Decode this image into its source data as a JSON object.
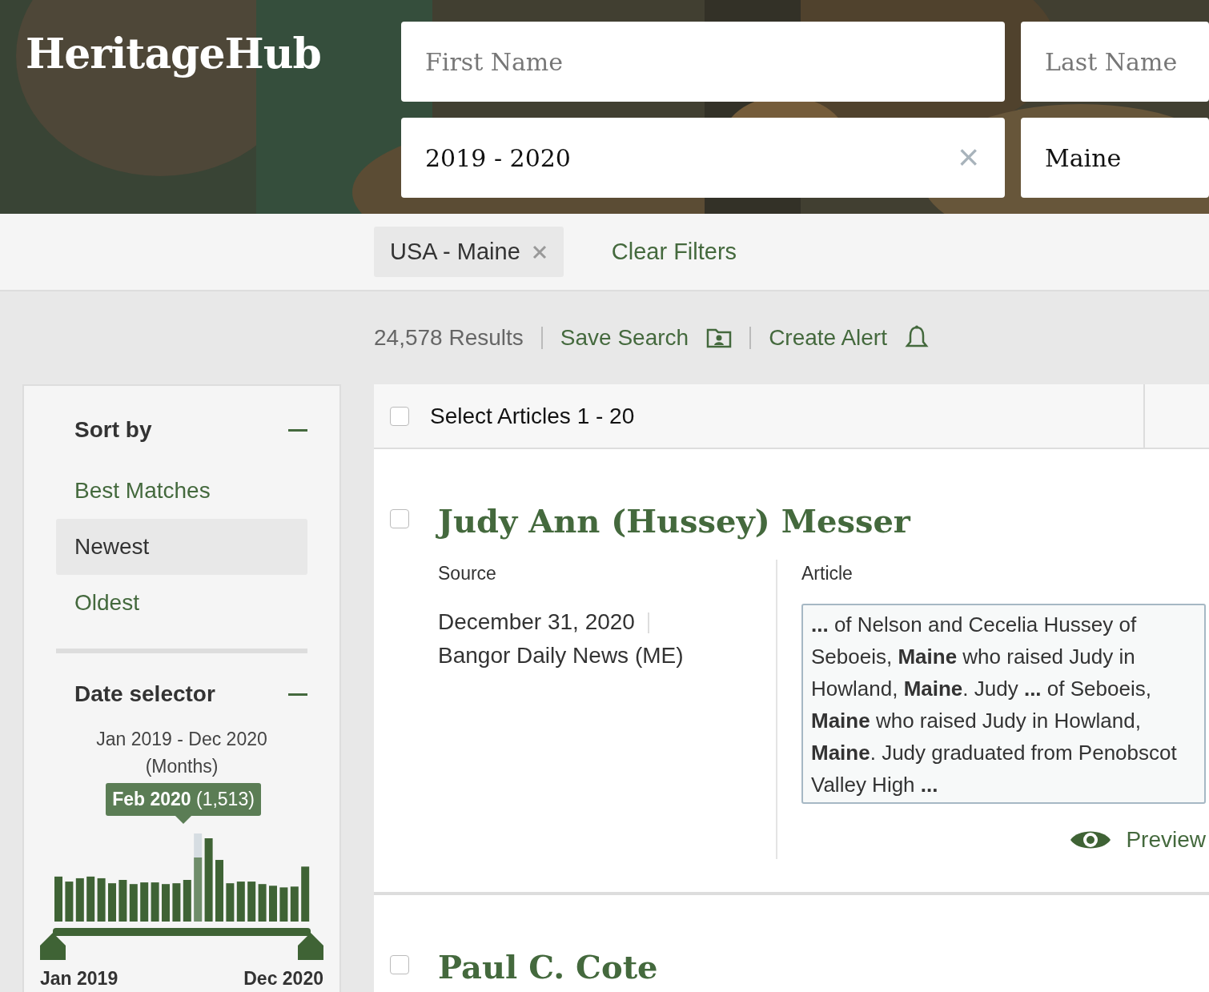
{
  "brand": "HeritageHub",
  "search_fields": [
    {
      "kind": "text",
      "placeholder": "First Name"
    },
    {
      "kind": "text",
      "placeholder": "Last Name"
    },
    {
      "kind": "clearable",
      "value": "2019 - 2020",
      "clear_icon": "×"
    },
    {
      "kind": "text",
      "value": "Maine"
    }
  ],
  "filters": {
    "chips": [
      {
        "label": "USA - Maine"
      }
    ],
    "clear_label": "Clear Filters"
  },
  "results_bar": {
    "count": "24,578 Results",
    "save_search": "Save Search",
    "create_alert": "Create Alert"
  },
  "sort": {
    "title": "Sort by",
    "options": [
      {
        "label": "Best Matches",
        "selected": false
      },
      {
        "label": "Newest",
        "selected": true
      },
      {
        "label": "Oldest",
        "selected": false
      }
    ]
  },
  "date_selector": {
    "title": "Date selector",
    "range": "Jan 2019 - Dec 2020",
    "unit": "(Months)",
    "tooltip": "**Feb 2020** (1,513)",
    "handles": [
      {
        "level": 0
      },
      {
        "level": 1
      }
    ],
    "start_label": "Jan 2019",
    "end_label": "Dec 2020"
  },
  "select_all": {
    "label": "Select Articles 1 - 20",
    "checked": false
  },
  "results": [
    {
      "title": "Judy Ann (Hussey) Messer",
      "checked": false,
      "source_label": "Source",
      "date": "December 31, 2020",
      "publication": "Bangor Daily News (ME)",
      "article_label": "Article",
      "snippet": "**...** of Nelson and Cecelia Hussey of Seboeis, **Maine** who raised Judy in Howland, **Maine**. Judy **...** of Seboeis, **Maine** who raised Judy in Howland, **Maine**. Judy graduated from Penobscot Valley High **...**",
      "preview": "Preview"
    },
    {
      "title": "Paul C. Cote",
      "checked": false
    }
  ]
}
